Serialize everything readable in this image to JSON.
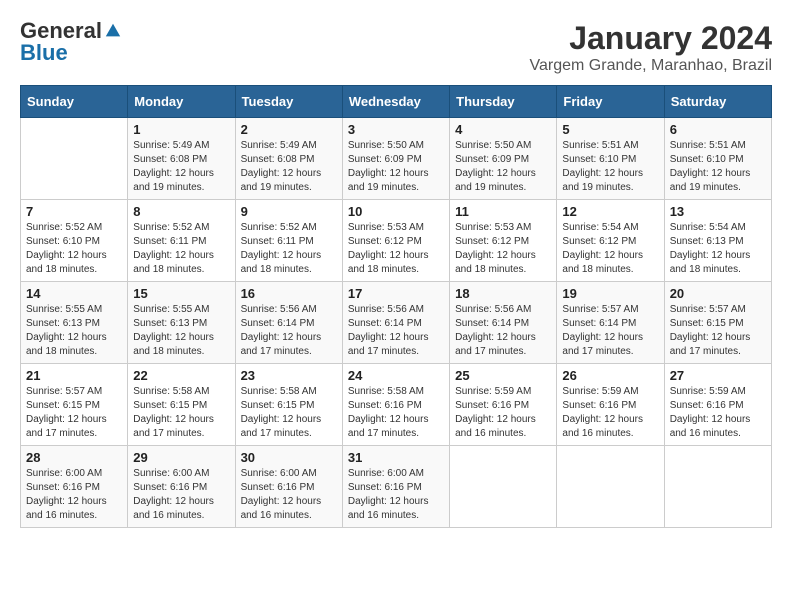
{
  "header": {
    "logo_general": "General",
    "logo_blue": "Blue",
    "month": "January 2024",
    "location": "Vargem Grande, Maranhao, Brazil"
  },
  "calendar": {
    "days_of_week": [
      "Sunday",
      "Monday",
      "Tuesday",
      "Wednesday",
      "Thursday",
      "Friday",
      "Saturday"
    ],
    "weeks": [
      [
        {
          "day": "",
          "sunrise": "",
          "sunset": "",
          "daylight": ""
        },
        {
          "day": "1",
          "sunrise": "Sunrise: 5:49 AM",
          "sunset": "Sunset: 6:08 PM",
          "daylight": "Daylight: 12 hours and 19 minutes."
        },
        {
          "day": "2",
          "sunrise": "Sunrise: 5:49 AM",
          "sunset": "Sunset: 6:08 PM",
          "daylight": "Daylight: 12 hours and 19 minutes."
        },
        {
          "day": "3",
          "sunrise": "Sunrise: 5:50 AM",
          "sunset": "Sunset: 6:09 PM",
          "daylight": "Daylight: 12 hours and 19 minutes."
        },
        {
          "day": "4",
          "sunrise": "Sunrise: 5:50 AM",
          "sunset": "Sunset: 6:09 PM",
          "daylight": "Daylight: 12 hours and 19 minutes."
        },
        {
          "day": "5",
          "sunrise": "Sunrise: 5:51 AM",
          "sunset": "Sunset: 6:10 PM",
          "daylight": "Daylight: 12 hours and 19 minutes."
        },
        {
          "day": "6",
          "sunrise": "Sunrise: 5:51 AM",
          "sunset": "Sunset: 6:10 PM",
          "daylight": "Daylight: 12 hours and 19 minutes."
        }
      ],
      [
        {
          "day": "7",
          "sunrise": "Sunrise: 5:52 AM",
          "sunset": "Sunset: 6:10 PM",
          "daylight": "Daylight: 12 hours and 18 minutes."
        },
        {
          "day": "8",
          "sunrise": "Sunrise: 5:52 AM",
          "sunset": "Sunset: 6:11 PM",
          "daylight": "Daylight: 12 hours and 18 minutes."
        },
        {
          "day": "9",
          "sunrise": "Sunrise: 5:52 AM",
          "sunset": "Sunset: 6:11 PM",
          "daylight": "Daylight: 12 hours and 18 minutes."
        },
        {
          "day": "10",
          "sunrise": "Sunrise: 5:53 AM",
          "sunset": "Sunset: 6:12 PM",
          "daylight": "Daylight: 12 hours and 18 minutes."
        },
        {
          "day": "11",
          "sunrise": "Sunrise: 5:53 AM",
          "sunset": "Sunset: 6:12 PM",
          "daylight": "Daylight: 12 hours and 18 minutes."
        },
        {
          "day": "12",
          "sunrise": "Sunrise: 5:54 AM",
          "sunset": "Sunset: 6:12 PM",
          "daylight": "Daylight: 12 hours and 18 minutes."
        },
        {
          "day": "13",
          "sunrise": "Sunrise: 5:54 AM",
          "sunset": "Sunset: 6:13 PM",
          "daylight": "Daylight: 12 hours and 18 minutes."
        }
      ],
      [
        {
          "day": "14",
          "sunrise": "Sunrise: 5:55 AM",
          "sunset": "Sunset: 6:13 PM",
          "daylight": "Daylight: 12 hours and 18 minutes."
        },
        {
          "day": "15",
          "sunrise": "Sunrise: 5:55 AM",
          "sunset": "Sunset: 6:13 PM",
          "daylight": "Daylight: 12 hours and 18 minutes."
        },
        {
          "day": "16",
          "sunrise": "Sunrise: 5:56 AM",
          "sunset": "Sunset: 6:14 PM",
          "daylight": "Daylight: 12 hours and 17 minutes."
        },
        {
          "day": "17",
          "sunrise": "Sunrise: 5:56 AM",
          "sunset": "Sunset: 6:14 PM",
          "daylight": "Daylight: 12 hours and 17 minutes."
        },
        {
          "day": "18",
          "sunrise": "Sunrise: 5:56 AM",
          "sunset": "Sunset: 6:14 PM",
          "daylight": "Daylight: 12 hours and 17 minutes."
        },
        {
          "day": "19",
          "sunrise": "Sunrise: 5:57 AM",
          "sunset": "Sunset: 6:14 PM",
          "daylight": "Daylight: 12 hours and 17 minutes."
        },
        {
          "day": "20",
          "sunrise": "Sunrise: 5:57 AM",
          "sunset": "Sunset: 6:15 PM",
          "daylight": "Daylight: 12 hours and 17 minutes."
        }
      ],
      [
        {
          "day": "21",
          "sunrise": "Sunrise: 5:57 AM",
          "sunset": "Sunset: 6:15 PM",
          "daylight": "Daylight: 12 hours and 17 minutes."
        },
        {
          "day": "22",
          "sunrise": "Sunrise: 5:58 AM",
          "sunset": "Sunset: 6:15 PM",
          "daylight": "Daylight: 12 hours and 17 minutes."
        },
        {
          "day": "23",
          "sunrise": "Sunrise: 5:58 AM",
          "sunset": "Sunset: 6:15 PM",
          "daylight": "Daylight: 12 hours and 17 minutes."
        },
        {
          "day": "24",
          "sunrise": "Sunrise: 5:58 AM",
          "sunset": "Sunset: 6:16 PM",
          "daylight": "Daylight: 12 hours and 17 minutes."
        },
        {
          "day": "25",
          "sunrise": "Sunrise: 5:59 AM",
          "sunset": "Sunset: 6:16 PM",
          "daylight": "Daylight: 12 hours and 16 minutes."
        },
        {
          "day": "26",
          "sunrise": "Sunrise: 5:59 AM",
          "sunset": "Sunset: 6:16 PM",
          "daylight": "Daylight: 12 hours and 16 minutes."
        },
        {
          "day": "27",
          "sunrise": "Sunrise: 5:59 AM",
          "sunset": "Sunset: 6:16 PM",
          "daylight": "Daylight: 12 hours and 16 minutes."
        }
      ],
      [
        {
          "day": "28",
          "sunrise": "Sunrise: 6:00 AM",
          "sunset": "Sunset: 6:16 PM",
          "daylight": "Daylight: 12 hours and 16 minutes."
        },
        {
          "day": "29",
          "sunrise": "Sunrise: 6:00 AM",
          "sunset": "Sunset: 6:16 PM",
          "daylight": "Daylight: 12 hours and 16 minutes."
        },
        {
          "day": "30",
          "sunrise": "Sunrise: 6:00 AM",
          "sunset": "Sunset: 6:16 PM",
          "daylight": "Daylight: 12 hours and 16 minutes."
        },
        {
          "day": "31",
          "sunrise": "Sunrise: 6:00 AM",
          "sunset": "Sunset: 6:16 PM",
          "daylight": "Daylight: 12 hours and 16 minutes."
        },
        {
          "day": "",
          "sunrise": "",
          "sunset": "",
          "daylight": ""
        },
        {
          "day": "",
          "sunrise": "",
          "sunset": "",
          "daylight": ""
        },
        {
          "day": "",
          "sunrise": "",
          "sunset": "",
          "daylight": ""
        }
      ]
    ]
  }
}
